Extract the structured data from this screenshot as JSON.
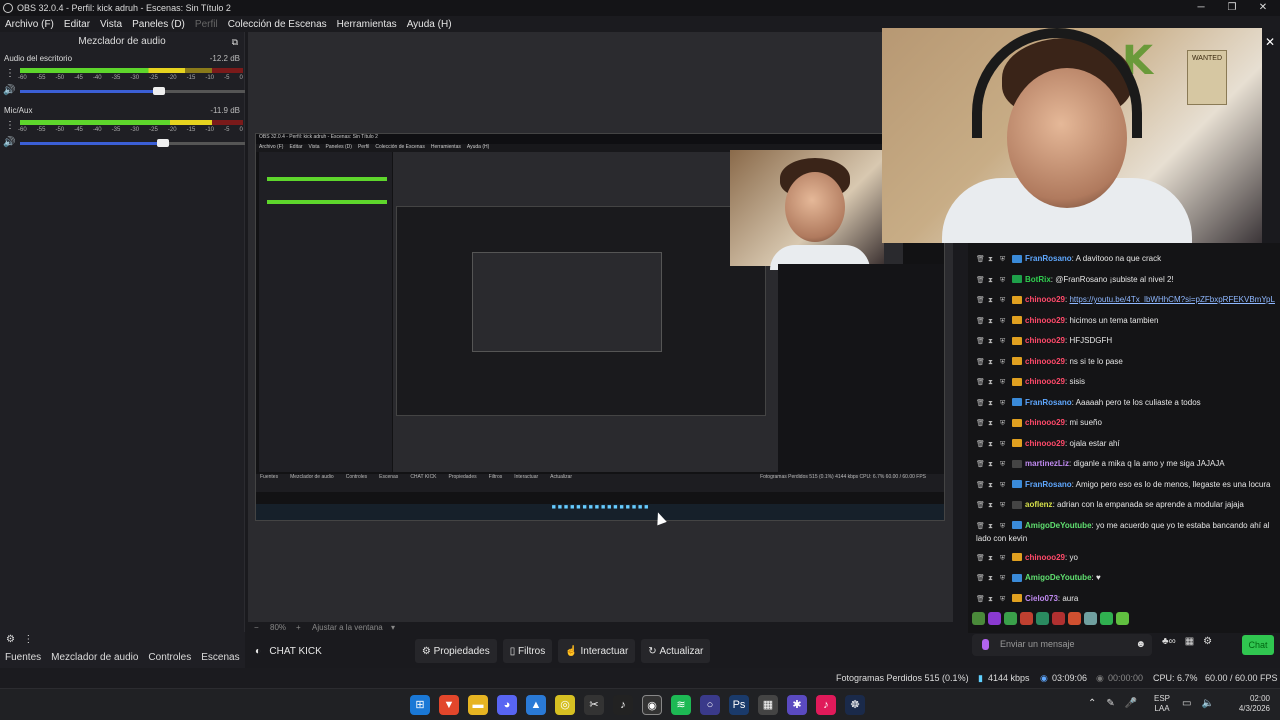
{
  "titlebar": {
    "title": "OBS 32.0.4 - Perfil: kick adruh - Escenas: Sin Título 2",
    "minimize": "─",
    "restore": "❐",
    "close": "✕"
  },
  "menu": {
    "items": [
      "Archivo (F)",
      "Editar",
      "Vista",
      "Paneles (D)",
      "Perfil",
      "Colección de Escenas",
      "Herramientas",
      "Ayuda (H)"
    ]
  },
  "mixer": {
    "title": "Mezclador de audio",
    "ticks": [
      "-60",
      "-55",
      "-50",
      "-45",
      "-40",
      "-35",
      "-30",
      "-25",
      "-20",
      "-15",
      "-10",
      "-5",
      "0"
    ],
    "tracks": [
      {
        "name": "Audio del escritorio",
        "db": "-12.2 dB",
        "level": 0.74,
        "volume": 0.63
      },
      {
        "name": "Mic/Aux",
        "db": "-11.9 dB",
        "level": 0.86,
        "volume": 0.65
      }
    ]
  },
  "dock": {
    "tabs": [
      "Fuentes",
      "Mezclador de audio",
      "Controles",
      "Escenas"
    ]
  },
  "nested": {
    "title": "OBS 32.0.4 - Perfil: kick adruh - Escenas: Sin Título 2",
    "menu": [
      "Archivo (F)",
      "Editar",
      "Vista",
      "Paneles (D)",
      "Perfil",
      "Colección de Escenas",
      "Herramientas",
      "Ayuda (H)"
    ],
    "bar": [
      "Fuentes",
      "Mezclador de audio",
      "Controles",
      "Escenas",
      "CHAT KICK",
      "Propiedades",
      "Filtros",
      "Interactuar",
      "Actualizar"
    ],
    "status": "Fotogramas Perdidos 515 (0.1%)   4144 kbps   CPU: 6.7%   60.00 / 60.00 FPS"
  },
  "webcam": {
    "poster": "WANTED",
    "letter": "K"
  },
  "chat": {
    "messages": [
      {
        "user": "FranRosano",
        "text": ": A davitooo na que crack",
        "color": "#5fa8ff",
        "badge": "#3a8ad8"
      },
      {
        "user": "BotRix",
        "text": ": @FranRosano ¡subiste al nivel 2!",
        "color": "#30d050",
        "badge": "#1ea04a"
      },
      {
        "user": "chinooo29",
        "text": ": ",
        "link": "https://youtu.be/4Tx_lbWHhCM?si=pZFbxpRFEKVBmYpL",
        "color": "#ff4a6a",
        "badge": "#e0a020"
      },
      {
        "user": "chinooo29",
        "text": ": hicimos un tema tambien",
        "color": "#ff4a6a",
        "badge": "#e0a020"
      },
      {
        "user": "chinooo29",
        "text": ": HFJSDGFH",
        "color": "#ff4a6a",
        "badge": "#e0a020"
      },
      {
        "user": "chinooo29",
        "text": ": ns si te lo pase",
        "color": "#ff4a6a",
        "badge": "#e0a020"
      },
      {
        "user": "chinooo29",
        "text": ": sisis",
        "color": "#ff4a6a",
        "badge": "#e0a020"
      },
      {
        "user": "FranRosano",
        "text": ": Aaaaah pero te los culiaste a todos",
        "color": "#5fa8ff",
        "badge": "#3a8ad8"
      },
      {
        "user": "chinooo29",
        "text": ": mi sueño",
        "color": "#ff4a6a",
        "badge": "#e0a020"
      },
      {
        "user": "chinooo29",
        "text": ": ojala estar ahí",
        "color": "#ff4a6a",
        "badge": "#e0a020"
      },
      {
        "user": "martinezLiz",
        "text": ": diganle a mika q la amo y me siga JAJAJA",
        "color": "#c08af0",
        "badge": "#444"
      },
      {
        "user": "FranRosano",
        "text": ": Amigo pero eso es lo de menos, llegaste es una locura",
        "color": "#5fa8ff",
        "badge": "#3a8ad8"
      },
      {
        "user": "aoflenz",
        "text": ": adrian con la empanada se aprende a modular jajaja",
        "color": "#d6e04a",
        "badge": "#444"
      },
      {
        "user": "AmigoDeYoutube",
        "text": ": yo me acuerdo que yo te estaba bancando ahí al lado con kevin",
        "color": "#60e070",
        "badge": "#3a8ad8"
      },
      {
        "user": "chinooo29",
        "text": ": yo",
        "color": "#ff4a6a",
        "badge": "#e0a020"
      },
      {
        "user": "AmigoDeYoutube",
        "text": ": ♥",
        "color": "#60e070",
        "badge": "#3a8ad8"
      },
      {
        "user": "Cielo073",
        "text": ": aura",
        "color": "#c08af0",
        "badge": "#e0a020"
      }
    ],
    "input_placeholder": "Enviar un mensaje",
    "send_label": "Chat"
  },
  "zoom": {
    "level": "80%",
    "fit_label": "Ajustar a la ventana"
  },
  "controls": {
    "source_name": "CHAT KICK",
    "buttons": [
      "Propiedades",
      "Filtros",
      "Interactuar",
      "Actualizar"
    ]
  },
  "status": {
    "dropped": "Fotogramas Perdidos 515 (0.1%)",
    "bitrate": "4144 kbps",
    "stream_time": "03:09:06",
    "rec_time": "00:00:00",
    "cpu": "CPU: 6.7%",
    "fps": "60.00 / 60.00 FPS"
  },
  "taskbar": {
    "lang_top": "ESP",
    "lang_bottom": "LAA",
    "time": "02:00",
    "date": "4/3/2026"
  }
}
